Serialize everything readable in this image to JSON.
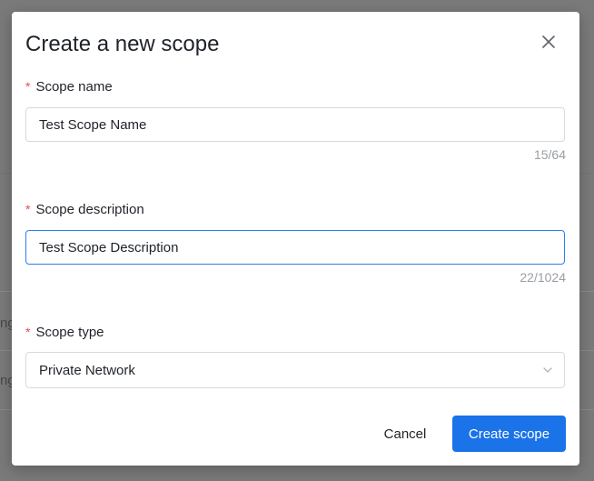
{
  "modal": {
    "title": "Create a new scope",
    "close_icon": "close-icon"
  },
  "fields": {
    "name": {
      "label": "Scope name",
      "value": "Test Scope Name",
      "counter": "15/64",
      "required": true
    },
    "description": {
      "label": "Scope description",
      "value": "Test Scope Description",
      "counter": "22/1024",
      "required": true
    },
    "type": {
      "label": "Scope type",
      "value": "Private Network",
      "required": true,
      "icon": "chevron-down-icon"
    }
  },
  "required_mark": "*",
  "footer": {
    "cancel_label": "Cancel",
    "submit_label": "Create scope"
  },
  "background": {
    "fragment_1": "ng",
    "fragment_2": "ng"
  },
  "colors": {
    "primary": "#1a73e8",
    "required": "#e34d59",
    "focus_border": "#2e7cf6",
    "counter_text": "#9a9ea4"
  }
}
